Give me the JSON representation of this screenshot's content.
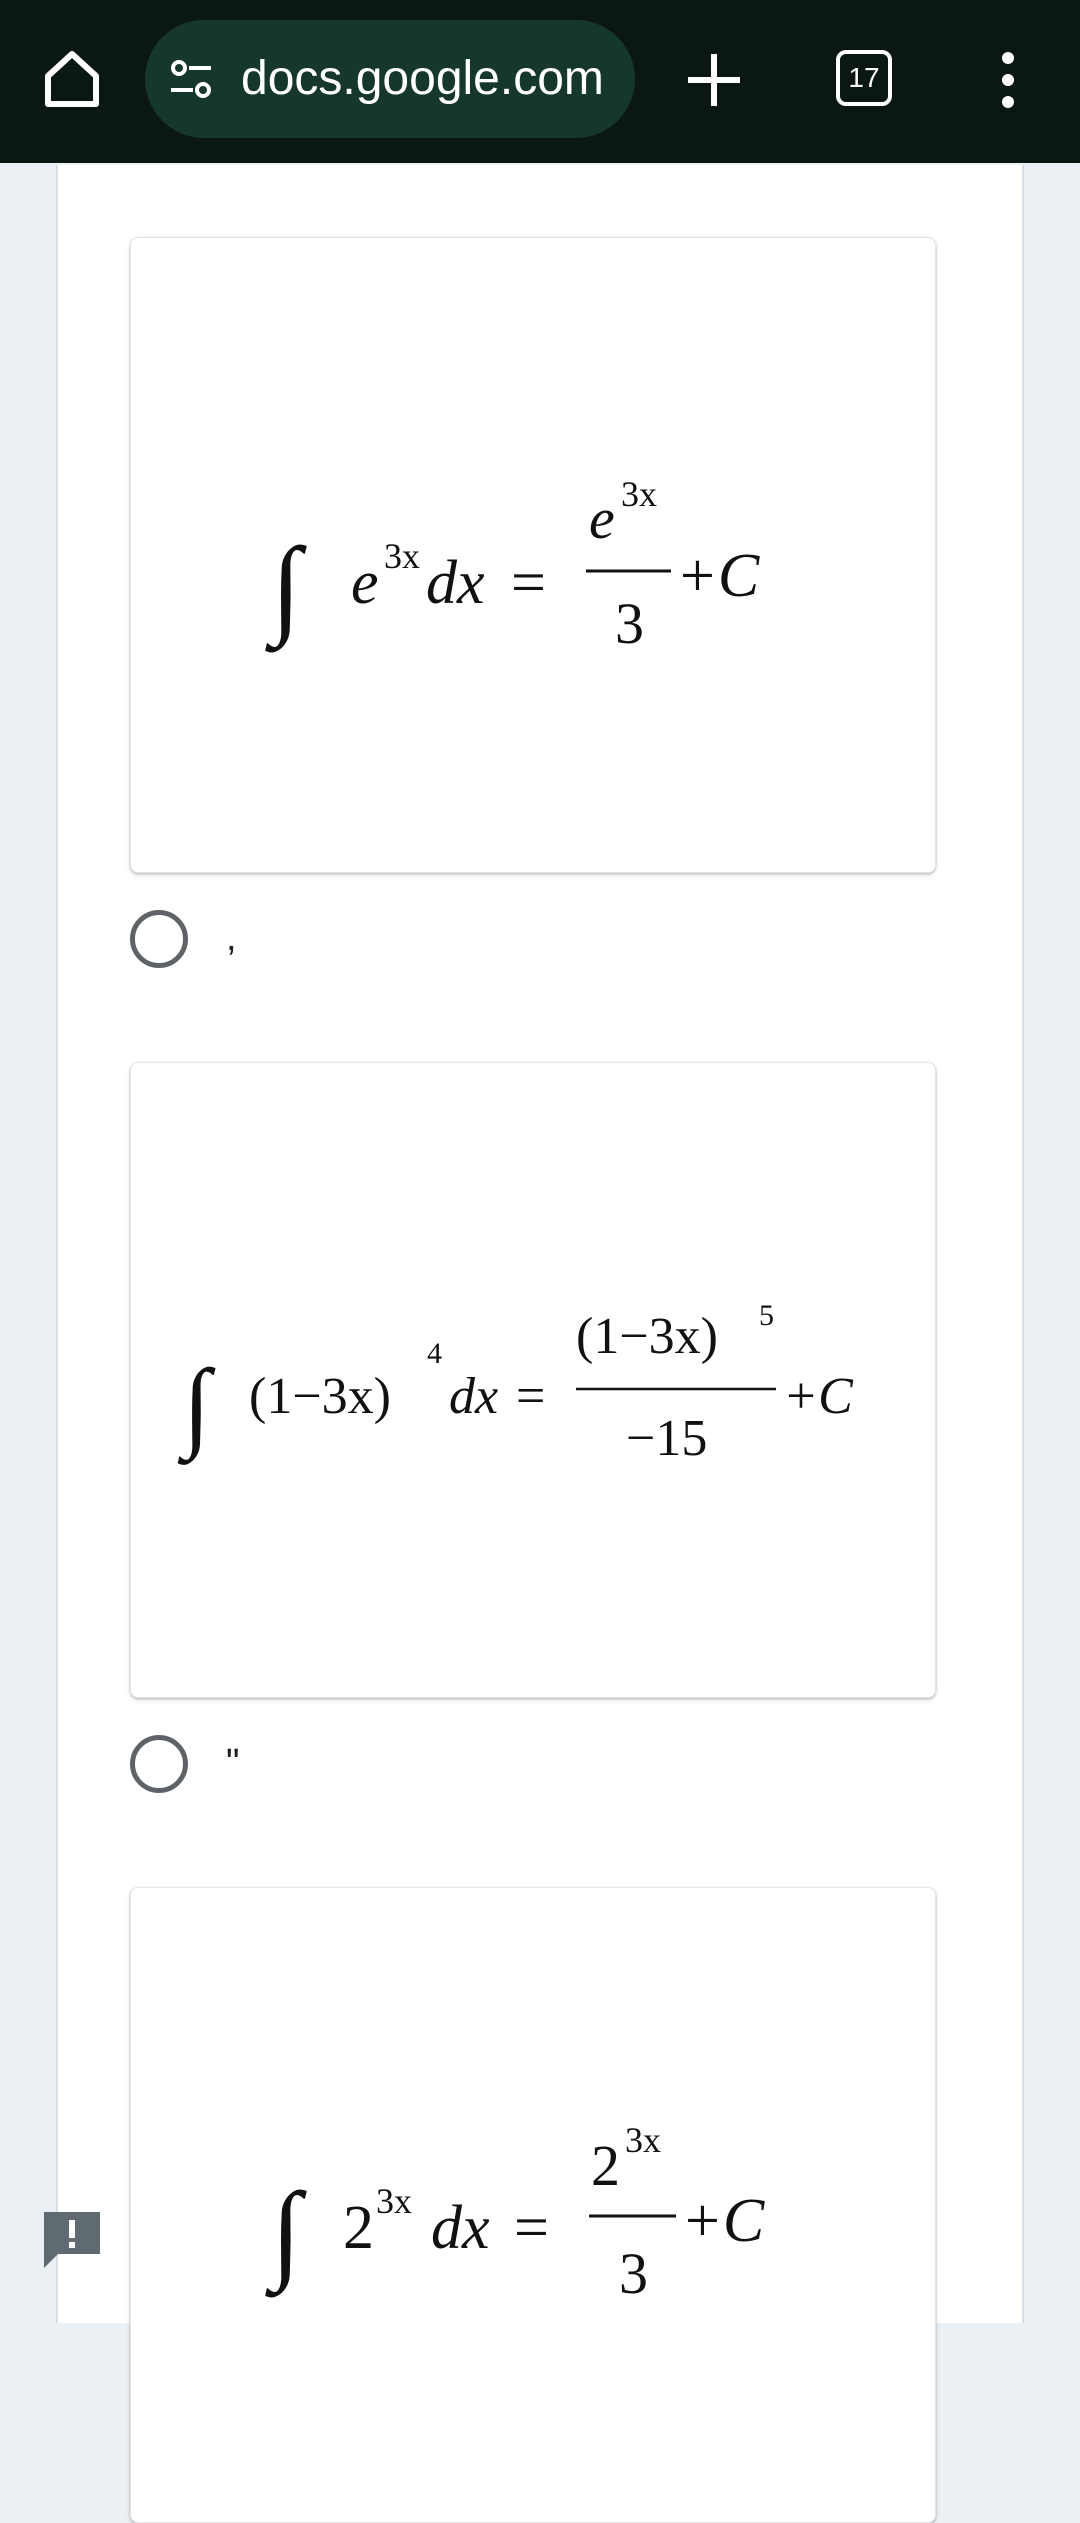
{
  "browser": {
    "url": "docs.google.com",
    "tab_count": "17",
    "icons": [
      "home-icon",
      "site-settings-icon",
      "new-tab-plus-icon",
      "tab-switcher-icon",
      "more-options-icon"
    ]
  },
  "options": [
    {
      "label": ",",
      "formula": {
        "lhs_base": "e",
        "lhs_exp": "3x",
        "rhs_num_base": "e",
        "rhs_num_exp": "3x",
        "rhs_den": "3",
        "tail": "+C",
        "dx": "dx",
        "eq": "="
      }
    },
    {
      "label": "\"",
      "formula": {
        "lhs_inner": "(1−3x)",
        "lhs_exp": "4",
        "rhs_num_inner": "(1−3x)",
        "rhs_num_exp": "5",
        "rhs_den": "−15",
        "tail": "+C",
        "dx": "dx",
        "eq": "="
      }
    },
    {
      "formula": {
        "lhs_base": "2",
        "lhs_exp": "3x",
        "rhs_num_base": "2",
        "rhs_num_exp": "3x",
        "rhs_den": "3",
        "tail": "+C",
        "dx": "dx",
        "eq": "="
      }
    }
  ],
  "feedback_icon": "report-feedback-icon"
}
